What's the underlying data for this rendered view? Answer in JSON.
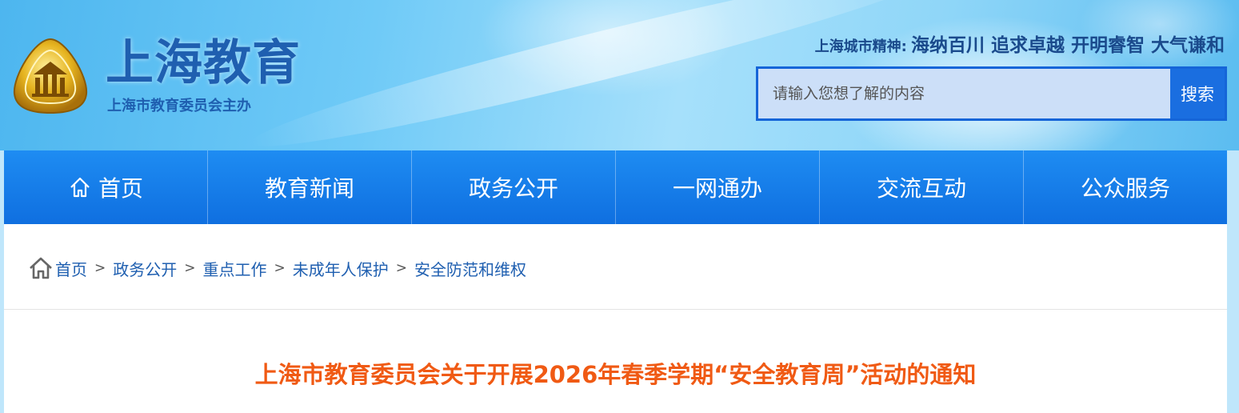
{
  "header": {
    "site_title": "上海教育",
    "site_subtitle": "上海市教育委员会主办",
    "motto_label": "上海城市精神:",
    "motto_text": "海纳百川 追求卓越 开明睿智 大气谦和",
    "search": {
      "placeholder": "请输入您想了解的内容",
      "button_label": "搜索"
    }
  },
  "nav": {
    "items": [
      {
        "label": "首页",
        "icon": "home-icon"
      },
      {
        "label": "教育新闻"
      },
      {
        "label": "政务公开"
      },
      {
        "label": "一网通办"
      },
      {
        "label": "交流互动"
      },
      {
        "label": "公众服务"
      }
    ]
  },
  "breadcrumb": {
    "icon": "home-icon",
    "separator": ">",
    "items": [
      "首页",
      "政务公开",
      "重点工作",
      "未成年人保护",
      "安全防范和维权"
    ]
  },
  "article": {
    "title": "上海市教育委员会关于开展2026年春季学期“安全教育周”活动的通知"
  },
  "colors": {
    "nav_bg": "#1679ea",
    "title_orange": "#f05a14",
    "brand_blue": "#1f5fb0"
  }
}
